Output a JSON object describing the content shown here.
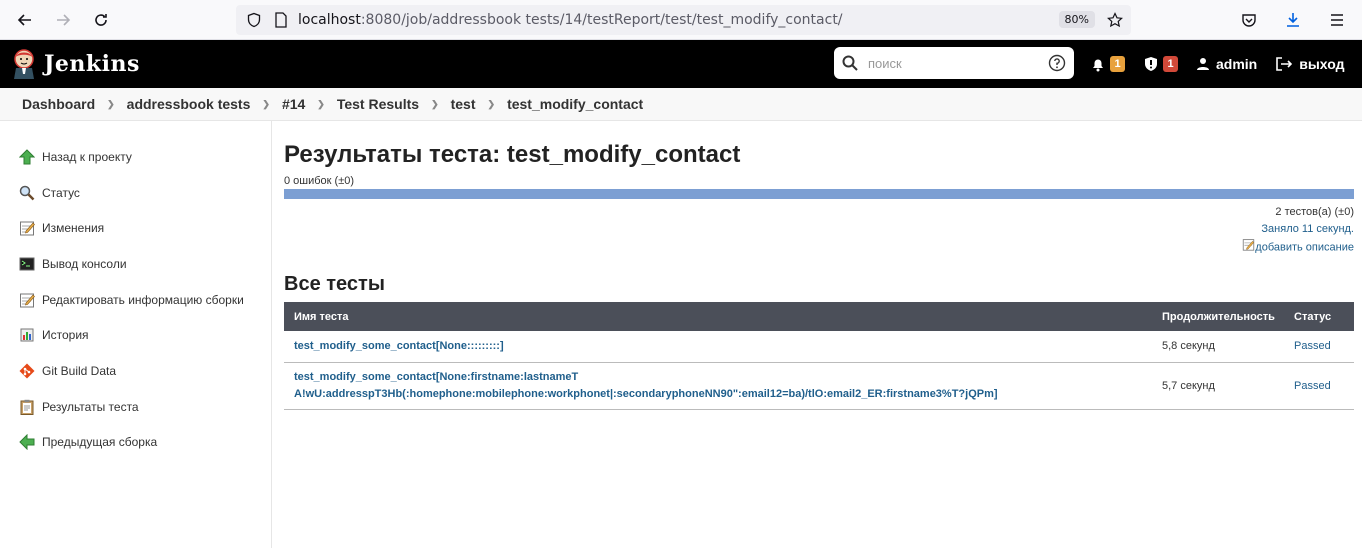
{
  "browser": {
    "url_host": "localhost",
    "url_rest": ":8080/job/addressbook tests/14/testReport/test/test_modify_contact/",
    "zoom": "80%"
  },
  "header": {
    "logo_text": "Jenkins",
    "search_placeholder": "поиск",
    "notifications_count": "1",
    "security_count": "1",
    "user": "admin",
    "logout": "выход"
  },
  "breadcrumb": [
    "Dashboard",
    "addressbook tests",
    "#14",
    "Test Results",
    "test",
    "test_modify_contact"
  ],
  "sidebar": {
    "items": [
      {
        "label": "Назад к проекту",
        "icon": "up-arrow-icon"
      },
      {
        "label": "Статус",
        "icon": "magnifier-icon"
      },
      {
        "label": "Изменения",
        "icon": "notepad-icon"
      },
      {
        "label": "Вывод консоли",
        "icon": "terminal-icon"
      },
      {
        "label": "Редактировать информацию сборки",
        "icon": "notepad-icon"
      },
      {
        "label": "История",
        "icon": "history-icon"
      },
      {
        "label": "Git Build Data",
        "icon": "git-icon"
      },
      {
        "label": "Результаты теста",
        "icon": "clipboard-icon"
      },
      {
        "label": "Предыдущая сборка",
        "icon": "left-arrow-icon"
      }
    ]
  },
  "main": {
    "title": "Результаты теста: test_modify_contact",
    "failures": "0 ошибок (±0)",
    "tests_total": "2 тестов(а) (±0)",
    "duration": "Заняло 11 секунд.",
    "add_description": "добавить описание",
    "all_tests_title": "Все тесты",
    "pass_fraction": 1.0
  },
  "table": {
    "headers": [
      "Имя теста",
      "Продолжительность",
      "Статус"
    ],
    "rows": [
      {
        "name": "test_modify_some_contact[None:::::::::]",
        "duration": "5,8 секунд",
        "status": "Passed"
      },
      {
        "name_line1": "test_modify_some_contact[None:firstname:lastnameT",
        "name_line2": "A!wU:addresspT3Hb(:homephone:mobilephone:workphonet|:secondaryphoneNN90\":email12=ba)/tlO:email2_ER:firstname3%T?jQPm]",
        "duration": "5,7 секунд",
        "status": "Passed"
      }
    ]
  },
  "colors": {
    "header_bg": "#000000",
    "progress_pass": "#7c9fd3",
    "link": "#205f8c",
    "table_header": "#4b4f59"
  }
}
